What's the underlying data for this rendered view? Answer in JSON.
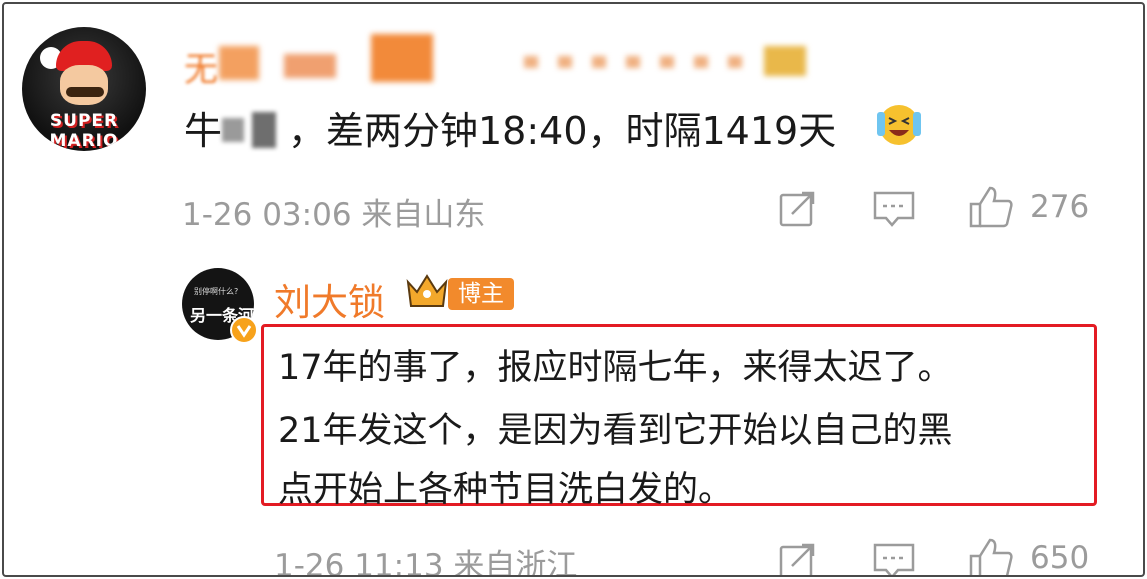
{
  "comment": {
    "author_visible": "无",
    "text_prefix": "牛",
    "text_main": "，差两分钟18:40，时隔1419天",
    "emoji": "crying-laughing-emoji",
    "timestamp": "1-26 03:06 来自山东",
    "like_count": "276"
  },
  "reply": {
    "author": "刘大锁",
    "badge": "博主",
    "avatar_small_text": "别停啊什么?",
    "avatar_big_text": "另一条河",
    "lines": [
      "17年的事了，报应时隔七年，来得太迟了。",
      "21年发这个，是因为看到它开始以自己的黑",
      "点开始上各种节目洗白发的。"
    ],
    "timestamp": "1-26 11:13 来自浙江",
    "like_count": "650"
  },
  "avatar_main_text": "SUPER MARIO",
  "colors": {
    "accent_orange": "#f07a2a",
    "highlight_red": "#e31b23",
    "meta_gray": "#9b9b9b"
  },
  "icons": [
    "share-icon",
    "comment-icon",
    "like-icon",
    "crown-icon",
    "verified-badge-icon"
  ]
}
